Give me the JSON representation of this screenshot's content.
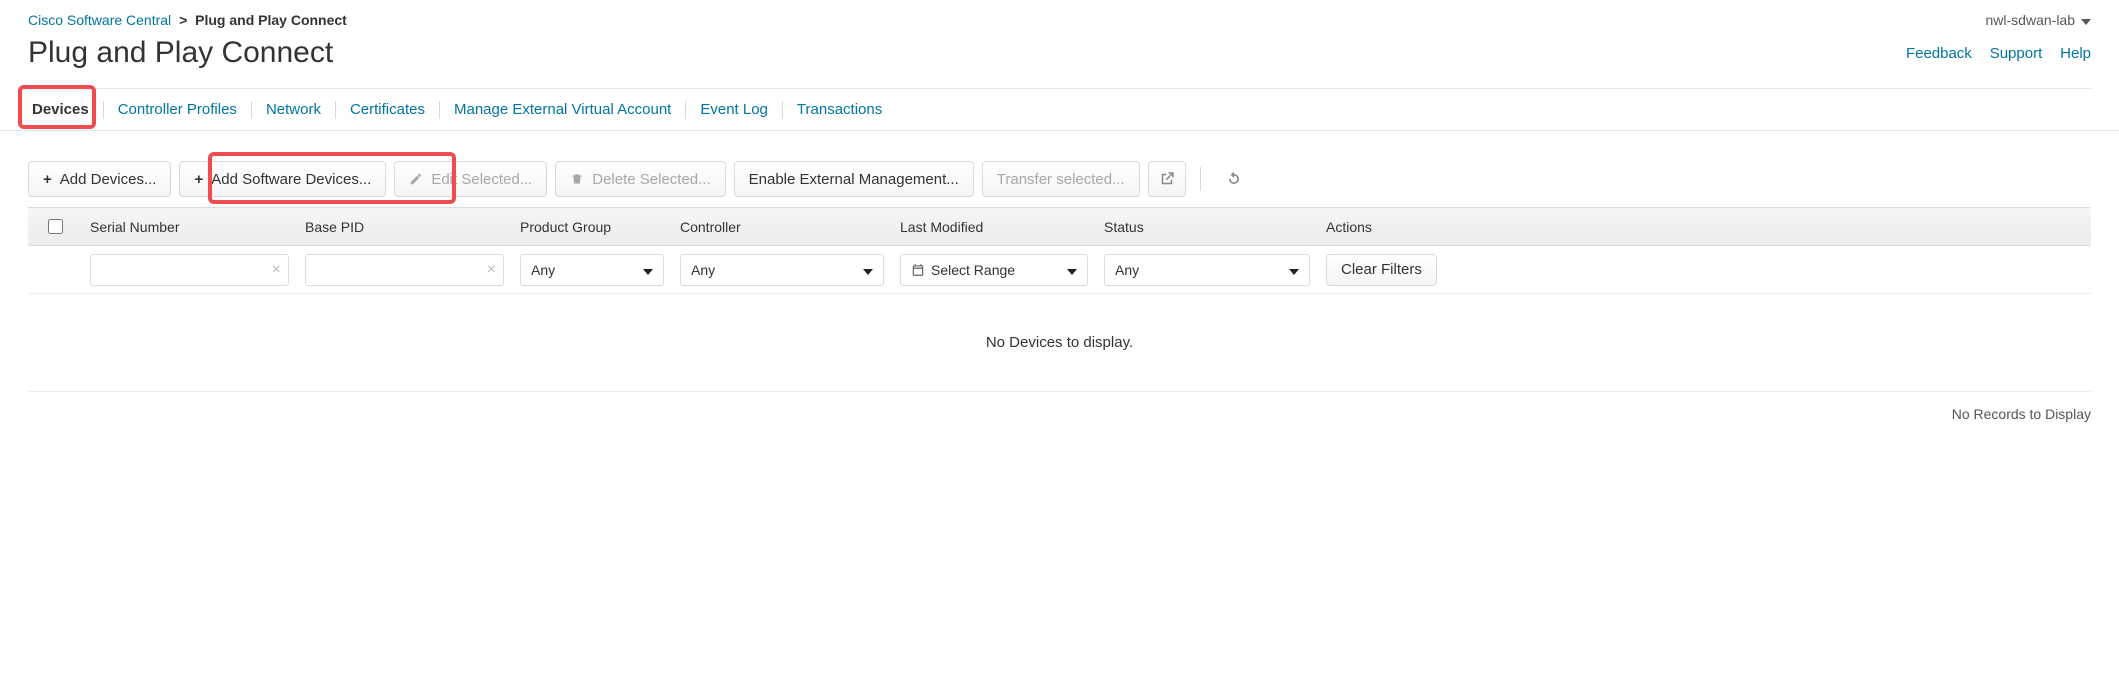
{
  "breadcrumb": {
    "root": "Cisco Software Central",
    "separator": ">",
    "current": "Plug and Play Connect"
  },
  "account": {
    "name": "nwl-sdwan-lab"
  },
  "page_title": "Plug and Play Connect",
  "help_links": {
    "feedback": "Feedback",
    "support": "Support",
    "help": "Help"
  },
  "tabs": [
    {
      "label": "Devices",
      "active": true
    },
    {
      "label": "Controller Profiles"
    },
    {
      "label": "Network"
    },
    {
      "label": "Certificates"
    },
    {
      "label": "Manage External Virtual Account"
    },
    {
      "label": "Event Log"
    },
    {
      "label": "Transactions"
    }
  ],
  "toolbar": {
    "add_devices": "Add Devices...",
    "add_sw_devices": "Add Software Devices...",
    "edit_selected": "Edit Selected...",
    "delete_selected": "Delete Selected...",
    "enable_ext_mgmt": "Enable External Management...",
    "transfer_selected": "Transfer selected..."
  },
  "columns": {
    "serial": "Serial Number",
    "pid": "Base PID",
    "pgroup": "Product Group",
    "controller": "Controller",
    "modified": "Last Modified",
    "status": "Status",
    "actions": "Actions"
  },
  "filters": {
    "any": "Any",
    "select_range": "Select Range",
    "clear": "Clear Filters"
  },
  "empty_message": "No Devices to display.",
  "footer": "No Records to Display"
}
